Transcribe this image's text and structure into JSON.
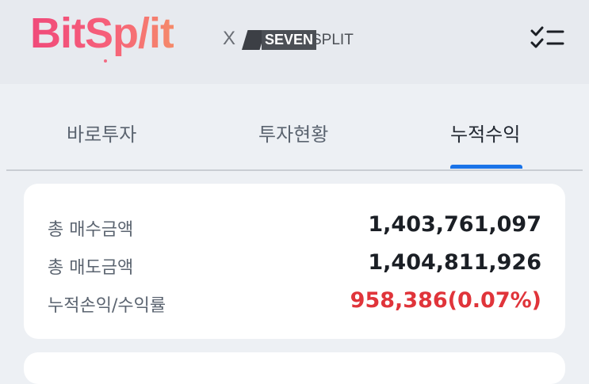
{
  "brand": {
    "logo_text": "BitSp/it",
    "times": "X",
    "partner_bold": "SEVEN",
    "partner_light": "SPLIT"
  },
  "header": {
    "menu_icon": "checklist-icon"
  },
  "tabs": [
    {
      "label": "바로투자",
      "active": false
    },
    {
      "label": "투자현황",
      "active": false
    },
    {
      "label": "누적수익",
      "active": true
    }
  ],
  "summary": {
    "total_buy_label": "총 매수금액",
    "total_buy_value": "1,403,761,097",
    "total_sell_label": "총 매도금액",
    "total_sell_value": "1,404,811,926",
    "profit_label": "누적손익/수익률",
    "profit_value": "958,386(0.07%)"
  },
  "colors": {
    "accent": "#1a73e8",
    "profit": "#e0343a",
    "logo_start": "#f04a7a",
    "logo_end": "#f58a6a"
  }
}
